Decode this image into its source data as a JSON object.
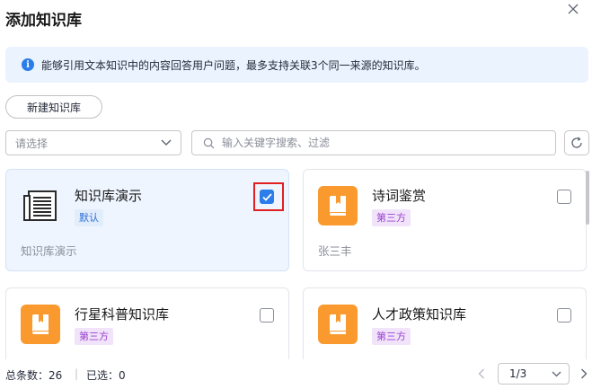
{
  "dialog": {
    "title": "添加知识库"
  },
  "banner": {
    "text": "能够引用文本知识中的内容回答用户问题，最多支持关联3个同一来源的知识库。"
  },
  "toolbar": {
    "new_kb_label": "新建知识库",
    "select_placeholder": "请选择",
    "search_placeholder": "输入关键字搜索、过滤"
  },
  "cards": [
    {
      "name": "知识库演示",
      "tag": "默认",
      "owner": "知识库演示",
      "checked": true,
      "icon": "document-icon"
    },
    {
      "name": "诗词鉴赏",
      "tag": "第三方",
      "owner": "张三丰",
      "checked": false,
      "icon": "book-icon"
    },
    {
      "name": "行星科普知识库",
      "tag": "第三方",
      "owner": "",
      "checked": false,
      "icon": "book-icon"
    },
    {
      "name": "人才政策知识库",
      "tag": "第三方",
      "owner": "",
      "checked": false,
      "icon": "book-icon"
    }
  ],
  "footer": {
    "total": "总条数：26",
    "separator": "|",
    "selected": "已选：0",
    "page": "1/3"
  },
  "colors": {
    "accent": "#2b7de9",
    "orange": "#fa9a2e",
    "highlight": "#e02020"
  }
}
